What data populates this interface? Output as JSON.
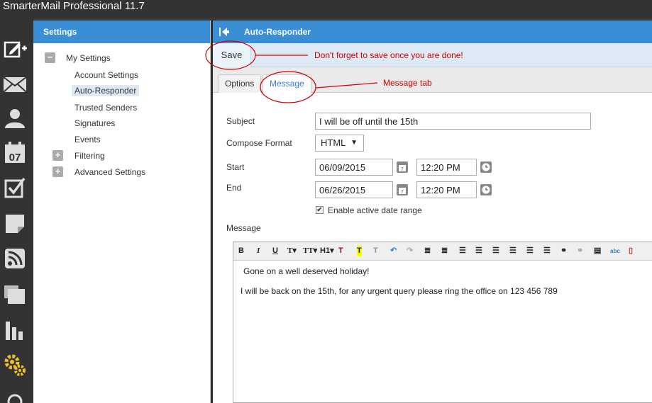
{
  "app": {
    "title": "SmarterMail Professional 11.7"
  },
  "rail": {
    "icons": [
      "compose-icon",
      "mail-icon",
      "contacts-icon",
      "calendar-icon",
      "tasks-icon",
      "notes-icon",
      "rss-icon",
      "files-icon",
      "reports-icon",
      "settings-gear-icon",
      "search-icon"
    ],
    "calendar_day": "07"
  },
  "settings": {
    "title": "Settings",
    "tree": {
      "my_settings": "My Settings",
      "account_settings": "Account Settings",
      "auto_responder": "Auto-Responder",
      "trusted_senders": "Trusted Senders",
      "signatures": "Signatures",
      "events": "Events",
      "filtering": "Filtering",
      "advanced_settings": "Advanced Settings"
    }
  },
  "main": {
    "title": "Auto-Responder",
    "save_label": "Save",
    "tabs": {
      "options": "Options",
      "message": "Message"
    },
    "form": {
      "subject_label": "Subject",
      "subject_value": "I will be off until the 15th",
      "compose_format_label": "Compose Format",
      "compose_format_value": "HTML",
      "start_label": "Start",
      "start_date": "06/09/2015",
      "start_time": "12:20 PM",
      "end_label": "End",
      "end_date": "06/26/2015",
      "end_time": "12:20 PM",
      "date_range_label": "Enable active date range",
      "date_range_checked": true,
      "message_label": "Message"
    },
    "editor": {
      "toolbar": {
        "bold": "B",
        "italic": "I",
        "underline": "U",
        "font": "T",
        "size": "T",
        "heading": "H1",
        "undo": "↶",
        "redo": "↷"
      },
      "line1": "Gone on a well deserved holiday!",
      "line2": "I will be back on the 15th, for any urgent query please ring the office on 123 456 789"
    }
  },
  "annotations": {
    "save_note": "Don't forget to save once you are done!",
    "tab_note": "Message tab",
    "color": "#d40000"
  },
  "colors": {
    "header_blue": "#3a8ed6",
    "rail_bg": "#333333",
    "toolbar_blue": "#dde9f5"
  }
}
